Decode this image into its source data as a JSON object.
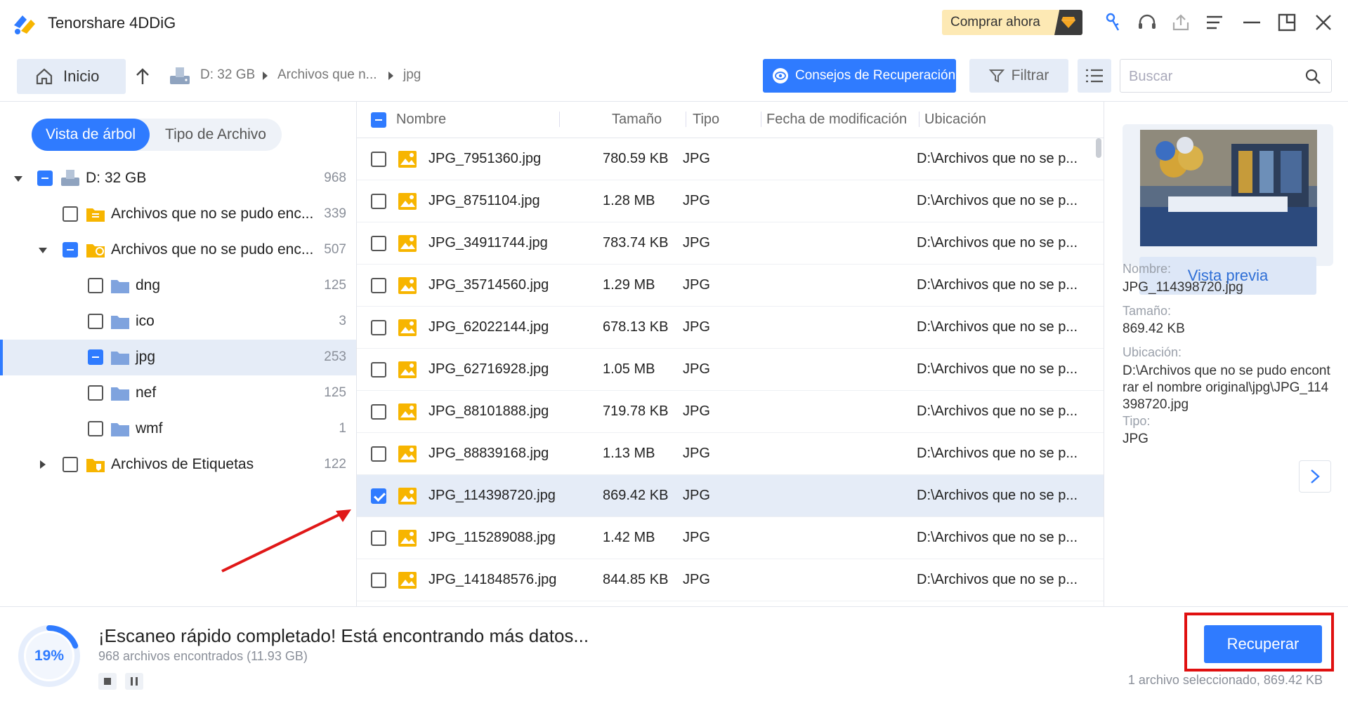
{
  "app": {
    "title": "Tenorshare 4DDiG",
    "buy_label": "Comprar ahora"
  },
  "toolbar": {
    "home_label": "Inicio",
    "breadcrumb": [
      "D: 32 GB",
      "Archivos que n...",
      "jpg"
    ],
    "tips_label": "Consejos de Recuperación",
    "filter_label": "Filtrar",
    "search_placeholder": "Buscar"
  },
  "view_toggle": {
    "tree": "Vista de árbol",
    "type": "Tipo de Archivo"
  },
  "tree": [
    {
      "label": "D: 32 GB",
      "count": "968"
    },
    {
      "label": "Archivos que no se pudo enc...",
      "count": "339"
    },
    {
      "label": "Archivos que no se pudo enc...",
      "count": "507"
    },
    {
      "label": "dng",
      "count": "125"
    },
    {
      "label": "ico",
      "count": "3"
    },
    {
      "label": "jpg",
      "count": "253"
    },
    {
      "label": "nef",
      "count": "125"
    },
    {
      "label": "wmf",
      "count": "1"
    },
    {
      "label": "Archivos de Etiquetas",
      "count": "122"
    }
  ],
  "table": {
    "headers": [
      "Nombre",
      "Tamaño",
      "Tipo",
      "Fecha de modificación",
      "Ubicación"
    ],
    "rows": [
      {
        "name": "JPG_7951360.jpg",
        "size": "780.59 KB",
        "type": "JPG",
        "date": "",
        "location": "D:\\Archivos que no se p..."
      },
      {
        "name": "JPG_8751104.jpg",
        "size": "1.28 MB",
        "type": "JPG",
        "date": "",
        "location": "D:\\Archivos que no se p..."
      },
      {
        "name": "JPG_34911744.jpg",
        "size": "783.74 KB",
        "type": "JPG",
        "date": "",
        "location": "D:\\Archivos que no se p..."
      },
      {
        "name": "JPG_35714560.jpg",
        "size": "1.29 MB",
        "type": "JPG",
        "date": "",
        "location": "D:\\Archivos que no se p..."
      },
      {
        "name": "JPG_62022144.jpg",
        "size": "678.13 KB",
        "type": "JPG",
        "date": "",
        "location": "D:\\Archivos que no se p..."
      },
      {
        "name": "JPG_62716928.jpg",
        "size": "1.05 MB",
        "type": "JPG",
        "date": "",
        "location": "D:\\Archivos que no se p..."
      },
      {
        "name": "JPG_88101888.jpg",
        "size": "719.78 KB",
        "type": "JPG",
        "date": "",
        "location": "D:\\Archivos que no se p..."
      },
      {
        "name": "JPG_88839168.jpg",
        "size": "1.13 MB",
        "type": "JPG",
        "date": "",
        "location": "D:\\Archivos que no se p..."
      },
      {
        "name": "JPG_114398720.jpg",
        "size": "869.42 KB",
        "type": "JPG",
        "date": "",
        "location": "D:\\Archivos que no se p..."
      },
      {
        "name": "JPG_115289088.jpg",
        "size": "1.42 MB",
        "type": "JPG",
        "date": "",
        "location": "D:\\Archivos que no se p..."
      },
      {
        "name": "JPG_141848576.jpg",
        "size": "844.85 KB",
        "type": "JPG",
        "date": "",
        "location": "D:\\Archivos que no se p..."
      }
    ]
  },
  "details": {
    "preview_label": "Vista previa",
    "name_label": "Nombre:",
    "name_value": "JPG_114398720.jpg",
    "size_label": "Tamaño:",
    "size_value": "869.42 KB",
    "location_label": "Ubicación:",
    "location_value": "D:\\Archivos que no se pudo encontrar el nombre original\\jpg\\JPG_114398720.jpg",
    "type_label": "Tipo:",
    "type_value": "JPG"
  },
  "status": {
    "progress": "19%",
    "title": "¡Escaneo rápido completado! Está encontrando más datos...",
    "subtitle": "968 archivos encontrados (11.93 GB)",
    "recover_label": "Recuperar",
    "selected_info": "1 archivo seleccionado, 869.42 KB"
  },
  "colors": {
    "accent": "#2f7bff",
    "highlight": "#e01010",
    "selected_row": "#e5ecf7"
  }
}
